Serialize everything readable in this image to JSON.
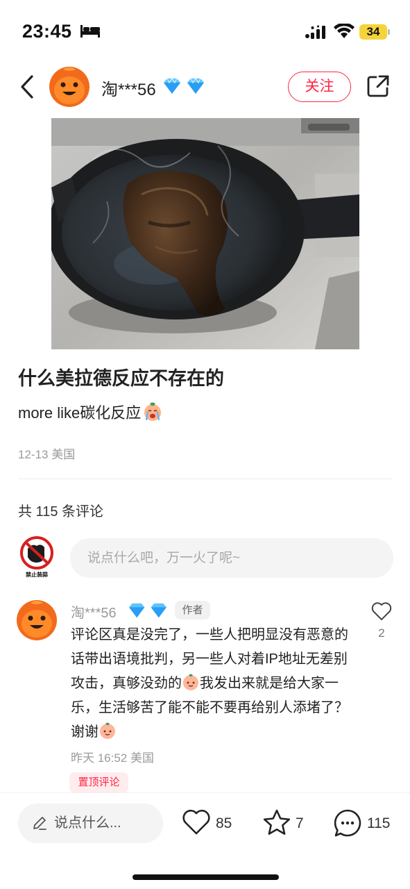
{
  "status_bar": {
    "time": "23:45",
    "battery": "34",
    "icons": [
      "bed-icon",
      "signal-icon",
      "wifi-icon",
      "battery-icon"
    ]
  },
  "header": {
    "username": "淘***56",
    "badges": [
      "diamond-icon",
      "diamond-icon"
    ],
    "follow_label": "关注",
    "icons": [
      "back-icon",
      "share-icon"
    ]
  },
  "post": {
    "image_alt": "cast-iron-skillet-with-charred-steak",
    "title": "什么美拉德反应不存在的",
    "body": "more like碳化反应",
    "body_emoji": "crying-emoji",
    "date": "12-13",
    "location": "美国"
  },
  "comments": {
    "count_label": "共 115 条评论",
    "input_placeholder": "说点什么吧，万一火了呢~",
    "my_avatar_label": "禁止装蒜",
    "items": [
      {
        "username": "淘***56",
        "author_tag": "作者",
        "text_parts": [
          "评论区真是没完了，一些人把明显没有恶意的话带出语境批判，另一些人对着IP地址无差别攻击，真够没劲的",
          "我发出来就是给大家一乐，生活够苦了能不能不要再给别人添堵了？谢谢"
        ],
        "time": "昨天 16:52",
        "location": "美国",
        "pinned_label": "置顶评论",
        "likes": "2"
      }
    ]
  },
  "bottom_bar": {
    "input_label": "说点什么...",
    "likes": "85",
    "stars": "7",
    "comments": "115"
  },
  "colors": {
    "accent": "#ff2442",
    "avatar_orange": "#f26a1b",
    "muted_text": "#9a9a9a"
  }
}
